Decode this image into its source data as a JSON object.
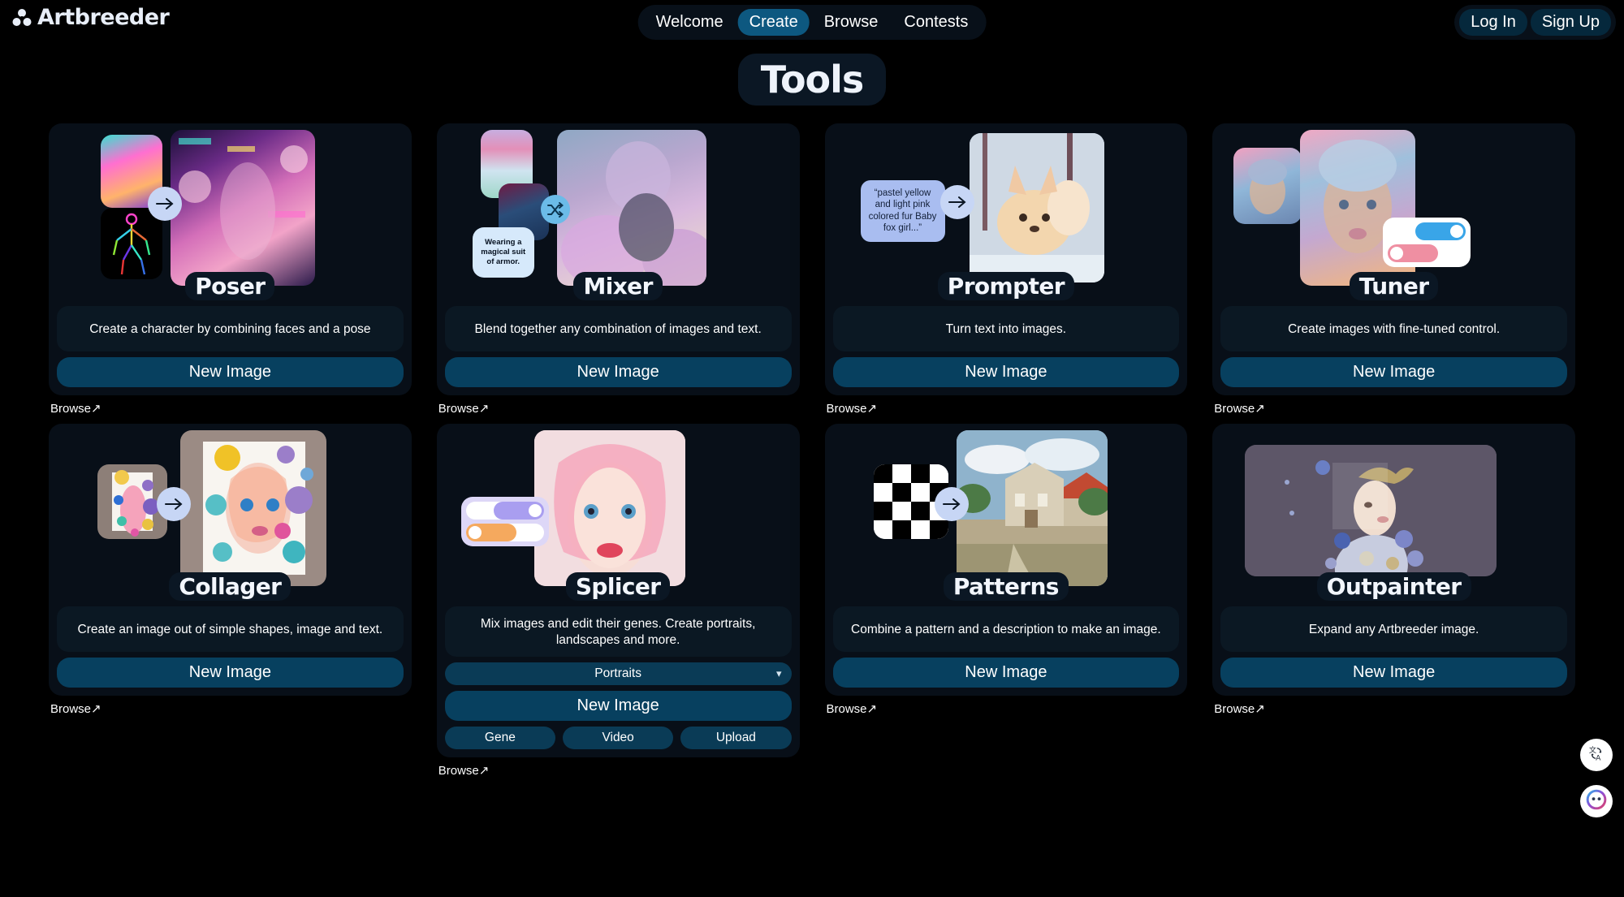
{
  "brand": {
    "name": "Artbreeder",
    "logo_icon": "three-circles-icon"
  },
  "nav": {
    "items": [
      {
        "label": "Welcome",
        "active": false
      },
      {
        "label": "Create",
        "active": true
      },
      {
        "label": "Browse",
        "active": false
      },
      {
        "label": "Contests",
        "active": false
      }
    ]
  },
  "auth": {
    "login_label": "Log In",
    "signup_label": "Sign Up"
  },
  "page": {
    "title": "Tools"
  },
  "browse_label": "Browse↗",
  "cards": [
    {
      "id": "poser",
      "title": "Poser",
      "description": "Create a character by combining faces and a pose",
      "primary_label": "New Image",
      "browse_label": "Browse↗"
    },
    {
      "id": "mixer",
      "title": "Mixer",
      "description": "Blend together any combination of images and text.",
      "primary_label": "New Image",
      "browse_label": "Browse↗",
      "bubble_text": "Wearing a magical suit of armor.",
      "mix_icon": "shuffle-icon"
    },
    {
      "id": "prompter",
      "title": "Prompter",
      "description": "Turn text into images.",
      "primary_label": "New Image",
      "browse_label": "Browse↗",
      "prompt_text": "“pastel yellow and light pink colored fur Baby fox girl...”"
    },
    {
      "id": "tuner",
      "title": "Tuner",
      "description": "Create images with fine-tuned control.",
      "primary_label": "New Image",
      "browse_label": "Browse↗",
      "toggle_on_color": "#39a5e8",
      "toggle_off_color": "#ef8fa2"
    },
    {
      "id": "collager",
      "title": "Collager",
      "description": "Create an image out of simple shapes, image and text.",
      "primary_label": "New Image",
      "browse_label": "Browse↗"
    },
    {
      "id": "splicer",
      "title": "Splicer",
      "description": "Mix images and edit their genes. Create portraits, landscapes and more.",
      "select_value": "Portraits",
      "primary_label": "New Image",
      "mini_buttons": [
        "Gene",
        "Video",
        "Upload"
      ],
      "browse_label": "Browse↗",
      "toggle_on_color": "#a99ef0",
      "toggle_off_color": "#f5a95e"
    },
    {
      "id": "patterns",
      "title": "Patterns",
      "description": "Combine a pattern and a description to make an image.",
      "primary_label": "New Image",
      "browse_label": "Browse↗"
    },
    {
      "id": "outpainter",
      "title": "Outpainter",
      "description": "Expand any Artbreeder image.",
      "primary_label": "New Image",
      "browse_label": "Browse↗"
    }
  ],
  "floating": {
    "translate_icon": "translate-icon",
    "assistant_icon": "assistant-icon"
  },
  "colors": {
    "page_bg": "#000000",
    "card_bg": "#080f18",
    "accent_blue": "#0d5880",
    "button_blue": "#07405f",
    "text": "#ffffff"
  }
}
